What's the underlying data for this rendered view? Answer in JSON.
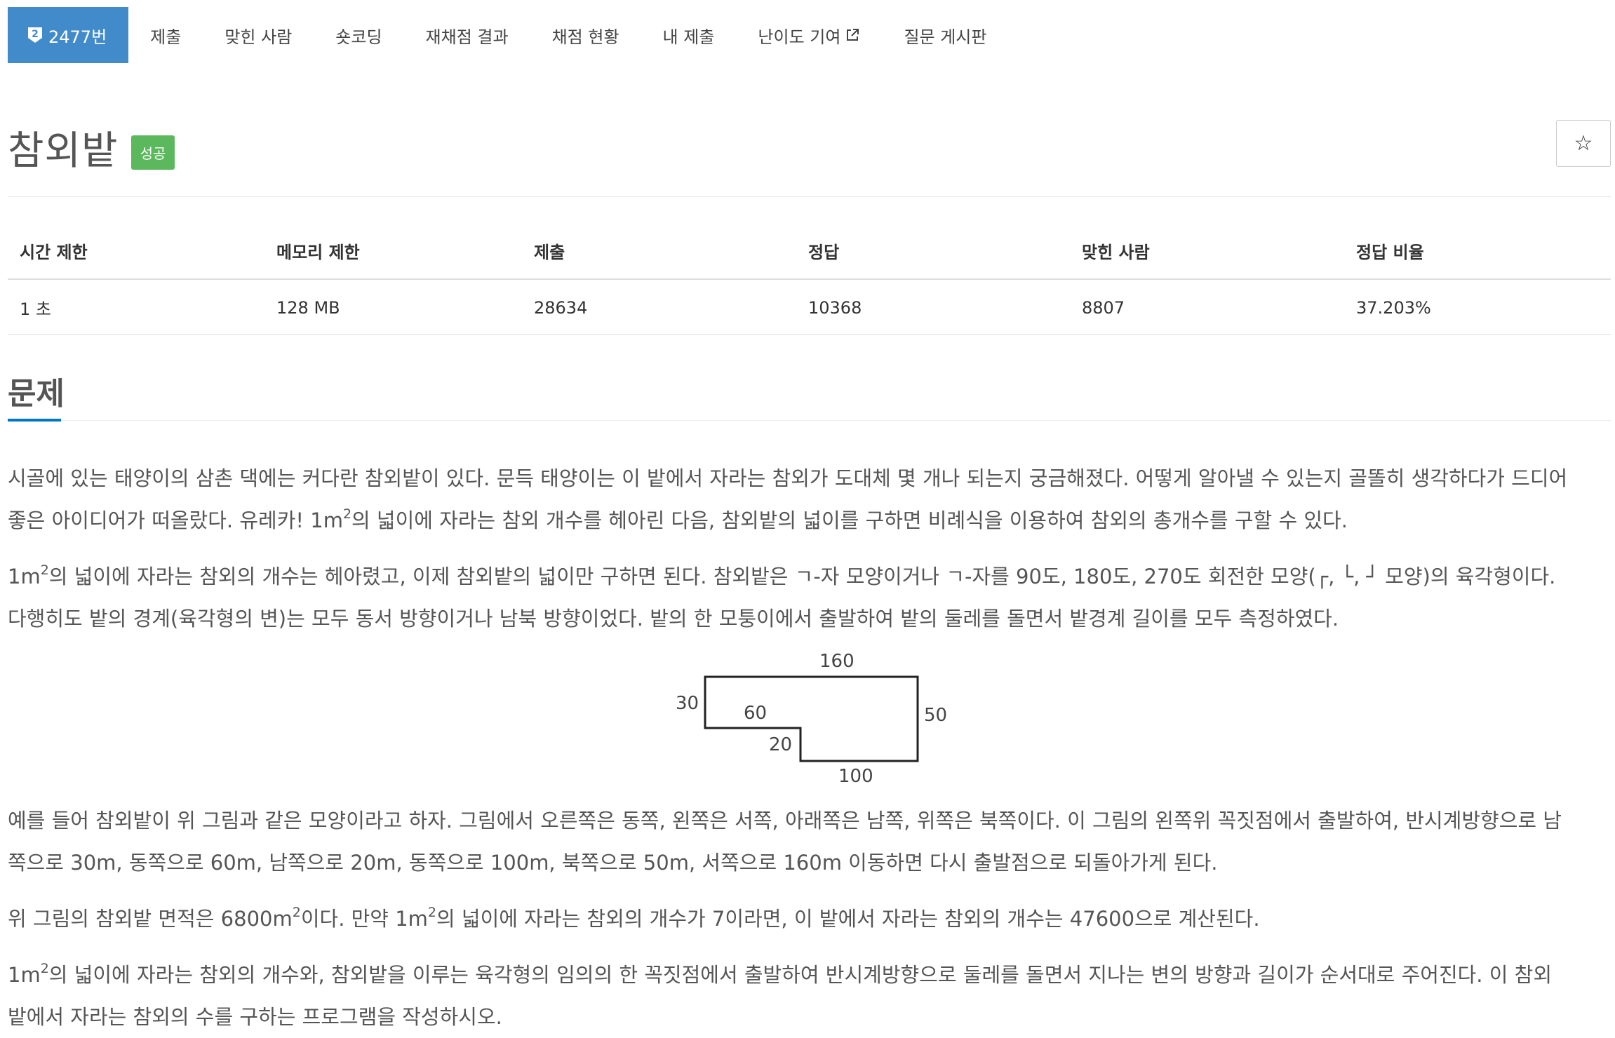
{
  "nav": {
    "problem_number": "2477번",
    "items": [
      "제출",
      "맞힌 사람",
      "숏코딩",
      "재채점 결과",
      "채점 현황",
      "내 제출",
      "난이도 기여",
      "질문 게시판"
    ]
  },
  "problem": {
    "title": "참외밭",
    "status": "성공",
    "star": "☆"
  },
  "stats": {
    "headers": [
      "시간 제한",
      "메모리 제한",
      "제출",
      "정답",
      "맞힌 사람",
      "정답 비율"
    ],
    "values": [
      "1 초",
      "128 MB",
      "28634",
      "10368",
      "8807",
      "37.203%"
    ]
  },
  "section": {
    "title": "문제"
  },
  "paragraphs": {
    "p1_a": "시골에 있는 태양이의 삼촌 댁에는 커다란 참외밭이 있다. 문득 태양이는 이 밭에서 자라는 참외가 도대체 몇 개나 되는지 궁금해졌다. 어떻게 알아낼 수 있는지 골똘히 생각하다가 드디어",
    "p1_b": "좋은 아이디어가 떠올랐다. 유레카! 1m",
    "p1_sup": "2",
    "p1_c": "의 넓이에 자라는 참외 개수를 헤아린 다음, 참외밭의 넓이를 구하면 비례식을 이용하여 참외의 총개수를 구할 수 있다.",
    "p2_a": "1m",
    "p2_sup": "2",
    "p2_b": "의 넓이에 자라는 참외의 개수는 헤아렸고, 이제 참외밭의 넓이만 구하면 된다. 참외밭은 ㄱ-자 모양이거나 ㄱ-자를 90도, 180도, 270도 회전한 모양(┌, └, ┘ 모양)의 육각형이다.",
    "p2_c": "다행히도 밭의 경계(육각형의 변)는 모두 동서 방향이거나 남북 방향이었다. 밭의 한 모퉁이에서 출발하여 밭의 둘레를 돌면서 밭경계 길이를 모두 측정하였다.",
    "p3_a": "예를 들어 참외밭이 위 그림과 같은 모양이라고 하자. 그림에서 오른쪽은 동쪽, 왼쪽은 서쪽, 아래쪽은 남쪽, 위쪽은 북쪽이다. 이 그림의 왼쪽위 꼭짓점에서 출발하여, 반시계방향으로 남",
    "p3_b": "쪽으로 30m, 동쪽으로 60m, 남쪽으로 20m, 동쪽으로 100m, 북쪽으로 50m, 서쪽으로 160m 이동하면 다시 출발점으로 되돌아가게 된다.",
    "p4_a": "위 그림의 참외밭  면적은 6800m",
    "p4_sup1": "2",
    "p4_b": "이다. 만약 1m",
    "p4_sup2": "2",
    "p4_c": "의 넓이에 자라는 참외의 개수가 7이라면, 이 밭에서 자라는 참외의 개수는 47600으로 계산된다.",
    "p5_a": "1m",
    "p5_sup": "2",
    "p5_b": "의 넓이에 자라는 참외의 개수와, 참외밭을 이루는 육각형의 임의의 한 꼭짓점에서 출발하여 반시계방향으로 둘레를 돌면서 지나는 변의 방향과 길이가 순서대로 주어진다. 이 참외",
    "p5_c": "밭에서 자라는 참외의 수를 구하는 프로그램을 작성하시오."
  },
  "figure": {
    "labels": [
      "160",
      "30",
      "60",
      "50",
      "20",
      "100"
    ]
  }
}
